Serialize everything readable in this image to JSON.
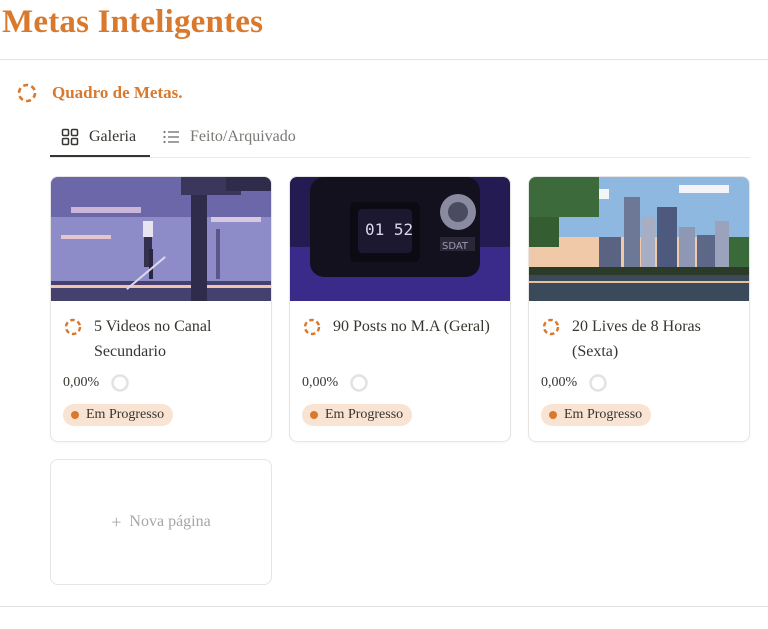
{
  "page": {
    "title": "Metas Inteligentes"
  },
  "database": {
    "title": "Quadro de Metas.",
    "icon": "goal-ring-icon"
  },
  "tabs": [
    {
      "label": "Galeria",
      "icon": "gallery-grid-icon",
      "active": true
    },
    {
      "label": "Feito/Arquivado",
      "icon": "list-icon",
      "active": false
    }
  ],
  "cards": [
    {
      "title": "5 Videos no Canal Secundario",
      "cover": "pixel-art-girl-with-sword",
      "progress": "0,00%",
      "status": "Em Progresso"
    },
    {
      "title": "90 Posts no M.A (Geral)",
      "cover": "pixel-art-digital-watch",
      "progress": "0,00%",
      "status": "Em Progresso"
    },
    {
      "title": "20 Lives de 8 Horas (Sexta)",
      "cover": "pixel-art-city-skyline",
      "progress": "0,00%",
      "status": "Em Progresso"
    }
  ],
  "new_page": {
    "label": "Nova página"
  },
  "colors": {
    "accent": "#d9792e",
    "badge_bg": "#f9e3d3",
    "text": "#37352f",
    "muted": "#787774"
  }
}
